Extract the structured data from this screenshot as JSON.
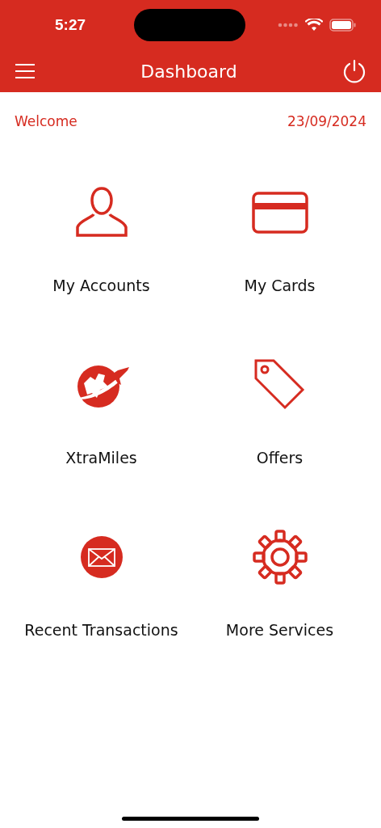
{
  "status_bar": {
    "time": "5:27"
  },
  "nav": {
    "title": "Dashboard"
  },
  "welcome": {
    "greeting": "Welcome",
    "date": "23/09/2024"
  },
  "tiles": [
    {
      "kind": "user",
      "label": "My Accounts"
    },
    {
      "kind": "card",
      "label": "My Cards"
    },
    {
      "kind": "globe",
      "label": "XtraMiles"
    },
    {
      "kind": "tag",
      "label": "Offers"
    },
    {
      "kind": "mail",
      "label": "Recent Transactions"
    },
    {
      "kind": "gear",
      "label": "More Services"
    }
  ]
}
